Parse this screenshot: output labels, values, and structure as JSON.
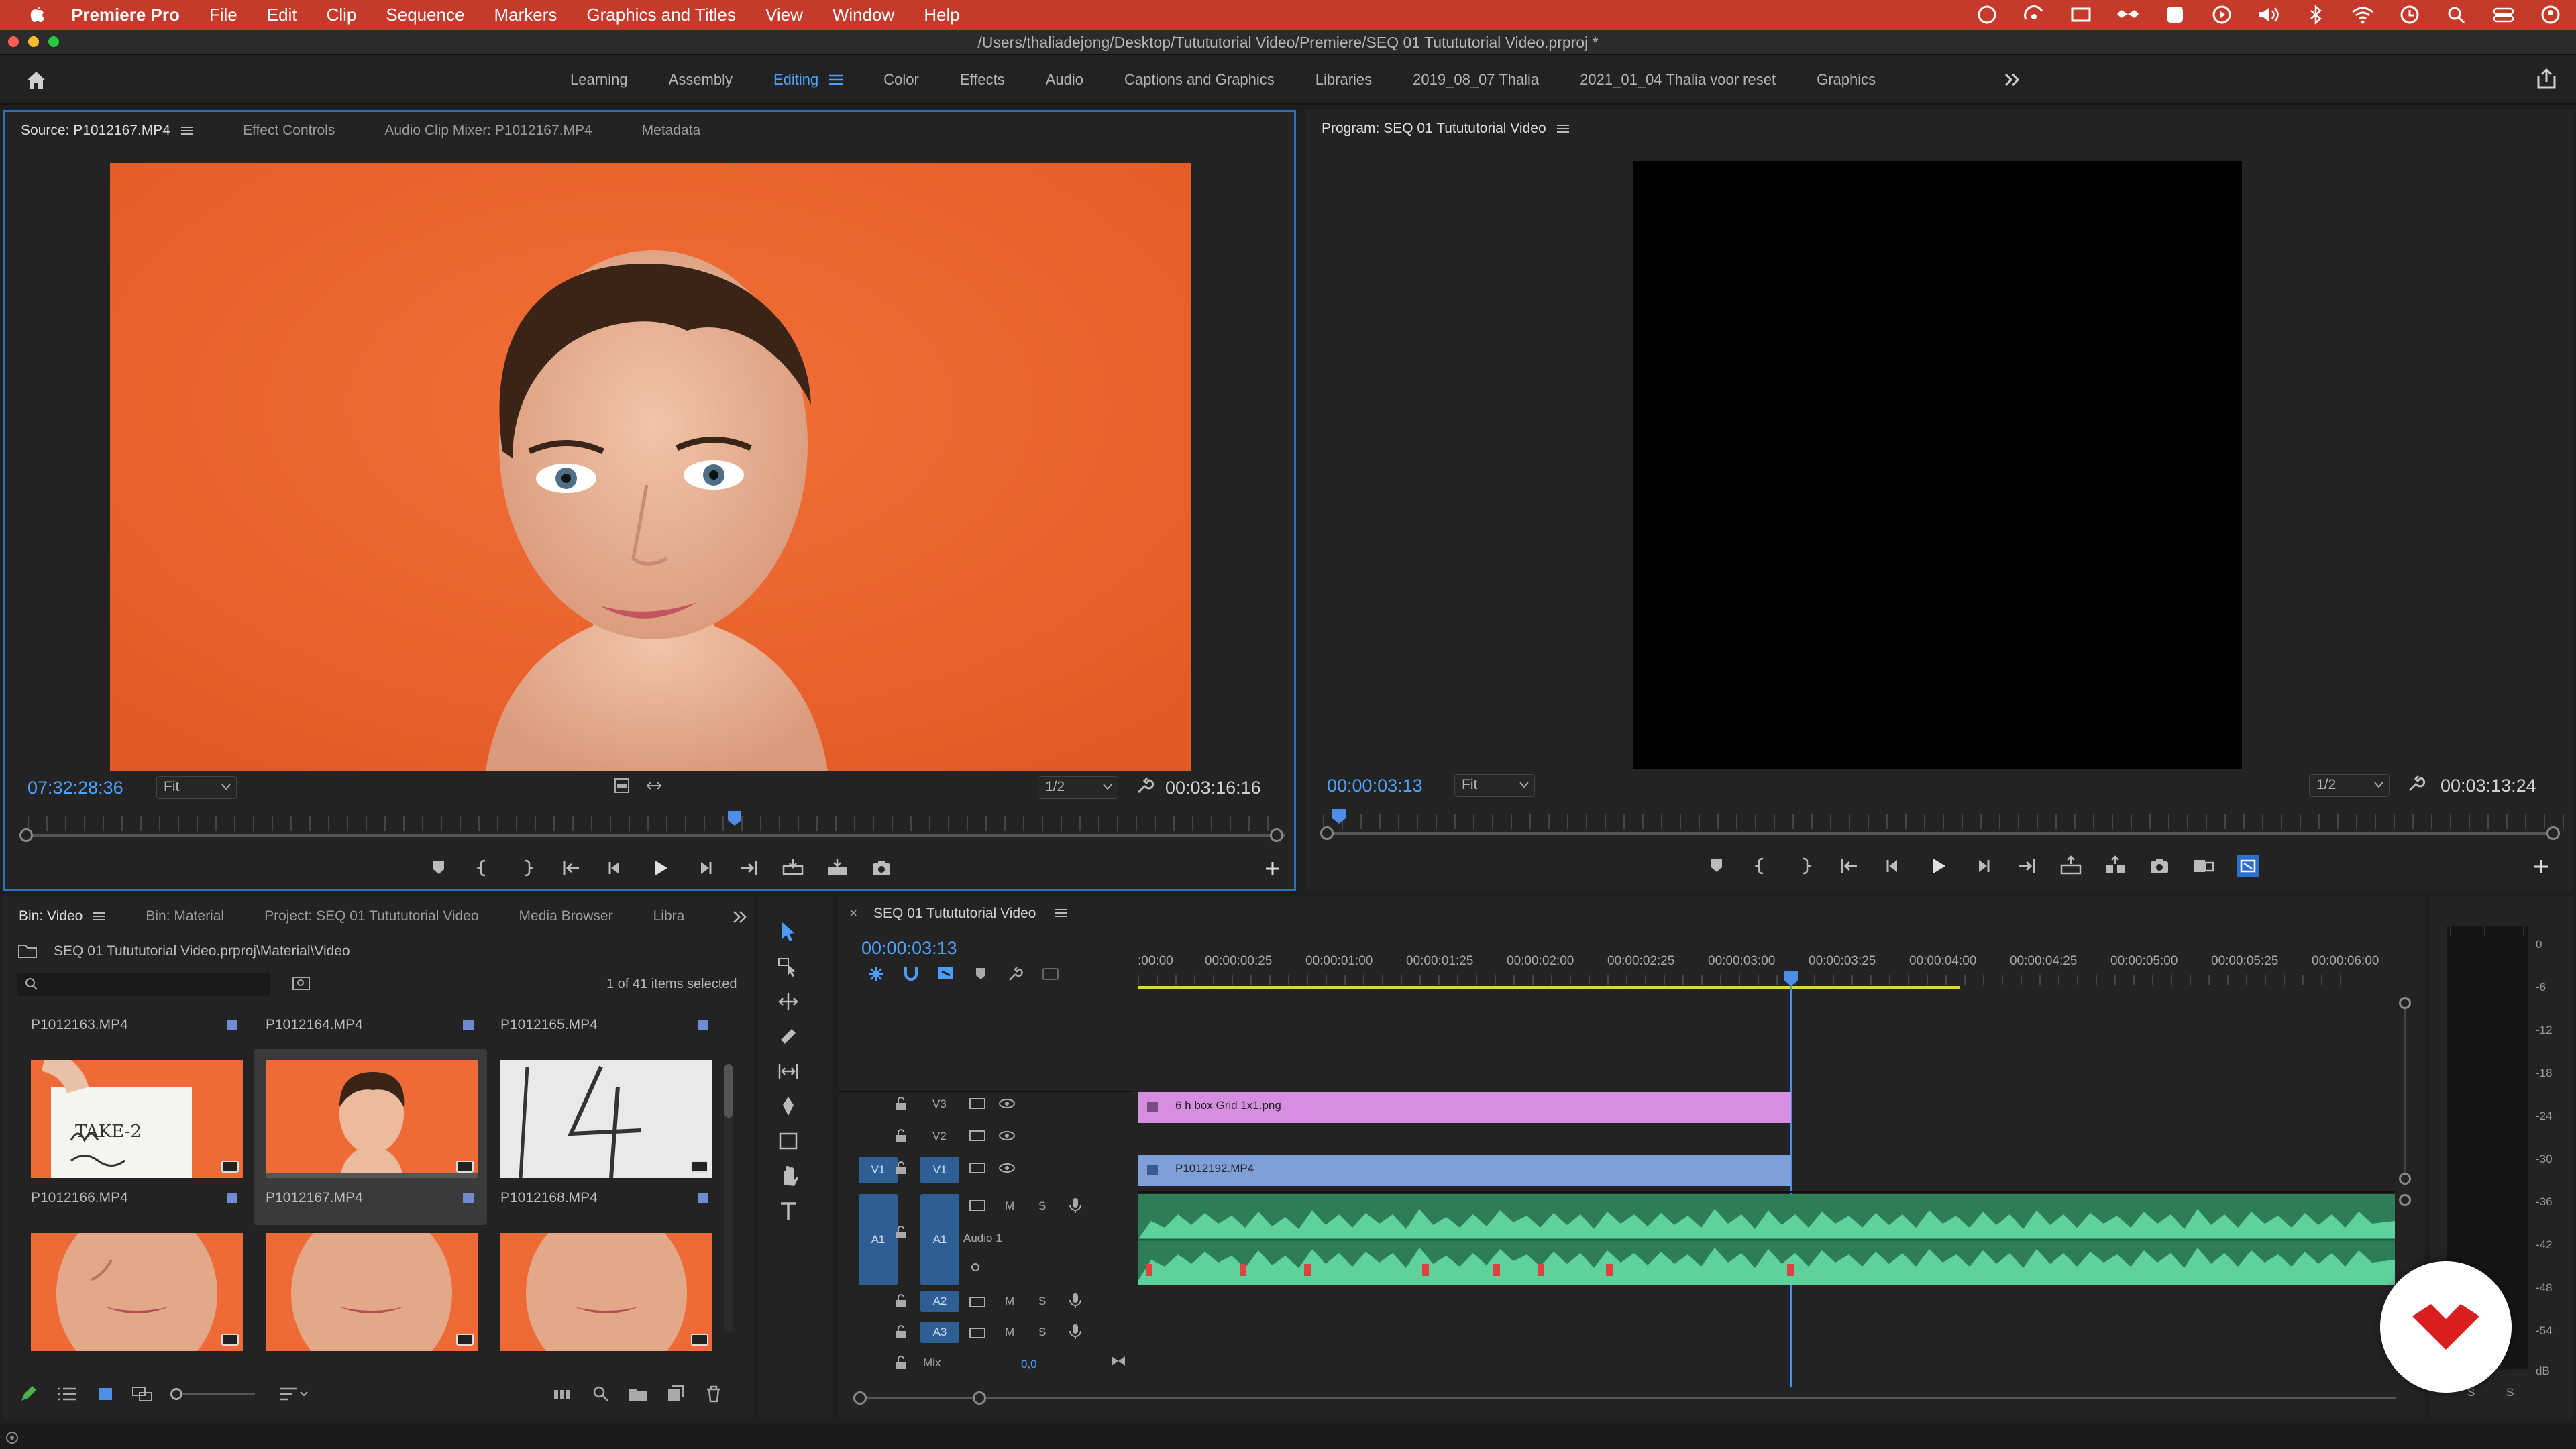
{
  "menubar": {
    "app_name": "Premiere Pro",
    "items": [
      "File",
      "Edit",
      "Clip",
      "Sequence",
      "Markers",
      "Graphics and Titles",
      "View",
      "Window",
      "Help"
    ]
  },
  "titlebar": {
    "path": "/Users/thaliadejong/Desktop/Tutututorial Video/Premiere/SEQ 01 Tutututorial Video.prproj *"
  },
  "workspaces": {
    "tabs": [
      "Learning",
      "Assembly",
      "Editing",
      "Color",
      "Effects",
      "Audio",
      "Captions and Graphics",
      "Libraries",
      "2019_08_07 Thalia",
      "2021_01_04 Thalia voor reset",
      "Graphics"
    ],
    "active": "Editing"
  },
  "source_monitor": {
    "tabs": [
      "Source: P1012167.MP4",
      "Effect Controls",
      "Audio Clip Mixer: P1012167.MP4",
      "Metadata"
    ],
    "timecode": "07:32:28:36",
    "zoom": "Fit",
    "resolution": "1/2",
    "duration": "00:03:16:16"
  },
  "program_monitor": {
    "title": "Program: SEQ 01 Tutututorial Video",
    "timecode": "00:00:03:13",
    "zoom": "Fit",
    "resolution": "1/2",
    "duration": "00:03:13:24"
  },
  "project_panel": {
    "tabs": [
      "Bin: Video",
      "Bin: Material",
      "Project: SEQ 01 Tutututorial Video",
      "Media Browser",
      "Libra"
    ],
    "path": "SEQ 01 Tutututorial Video.prproj\\Material\\Video",
    "selection": "1 of 41 items selected",
    "row1": [
      "P1012163.MP4",
      "P1012164.MP4",
      "P1012165.MP4"
    ],
    "row2": [
      "P1012166.MP4",
      "P1012167.MP4",
      "P1012168.MP4"
    ],
    "slate_text": "TAKE-2"
  },
  "timeline": {
    "sequence": "SEQ 01 Tutututorial Video",
    "timecode": "00:00:03:13",
    "ruler": [
      ":00:00",
      "00:00:00:25",
      "00:00:01:00",
      "00:00:01:25",
      "00:00:02:00",
      "00:00:02:25",
      "00:00:03:00",
      "00:00:03:25",
      "00:00:04:00",
      "00:00:04:25",
      "00:00:05:00",
      "00:00:05:25",
      "00:00:06:00"
    ],
    "tracks": {
      "v3": "V3",
      "v2": "V2",
      "v1": "V1",
      "src_v1": "V1",
      "a1": "A1",
      "src_a1": "A1",
      "a2": "A2",
      "a3": "A3",
      "audio1_label": "Audio 1",
      "mix_label": "Mix",
      "mix_value": "0,0",
      "m": "M",
      "s": "S"
    },
    "clips": {
      "graphic": "6 h box Grid 1x1.png",
      "video": "P1012192.MP4"
    }
  },
  "audio_meter": {
    "scale": [
      "0",
      "-6",
      "-12",
      "-18",
      "-24",
      "-30",
      "-36",
      "-42",
      "-48",
      "-54",
      "dB"
    ],
    "solo": [
      "S",
      "S"
    ]
  },
  "colors": {
    "accent": "#4da3ff",
    "menubar": "#c63a2c",
    "orange": "#ef6530",
    "graphic_clip": "#d68fe0",
    "video_clip": "#7f9fd9",
    "audio_clip": "#3fae77"
  }
}
